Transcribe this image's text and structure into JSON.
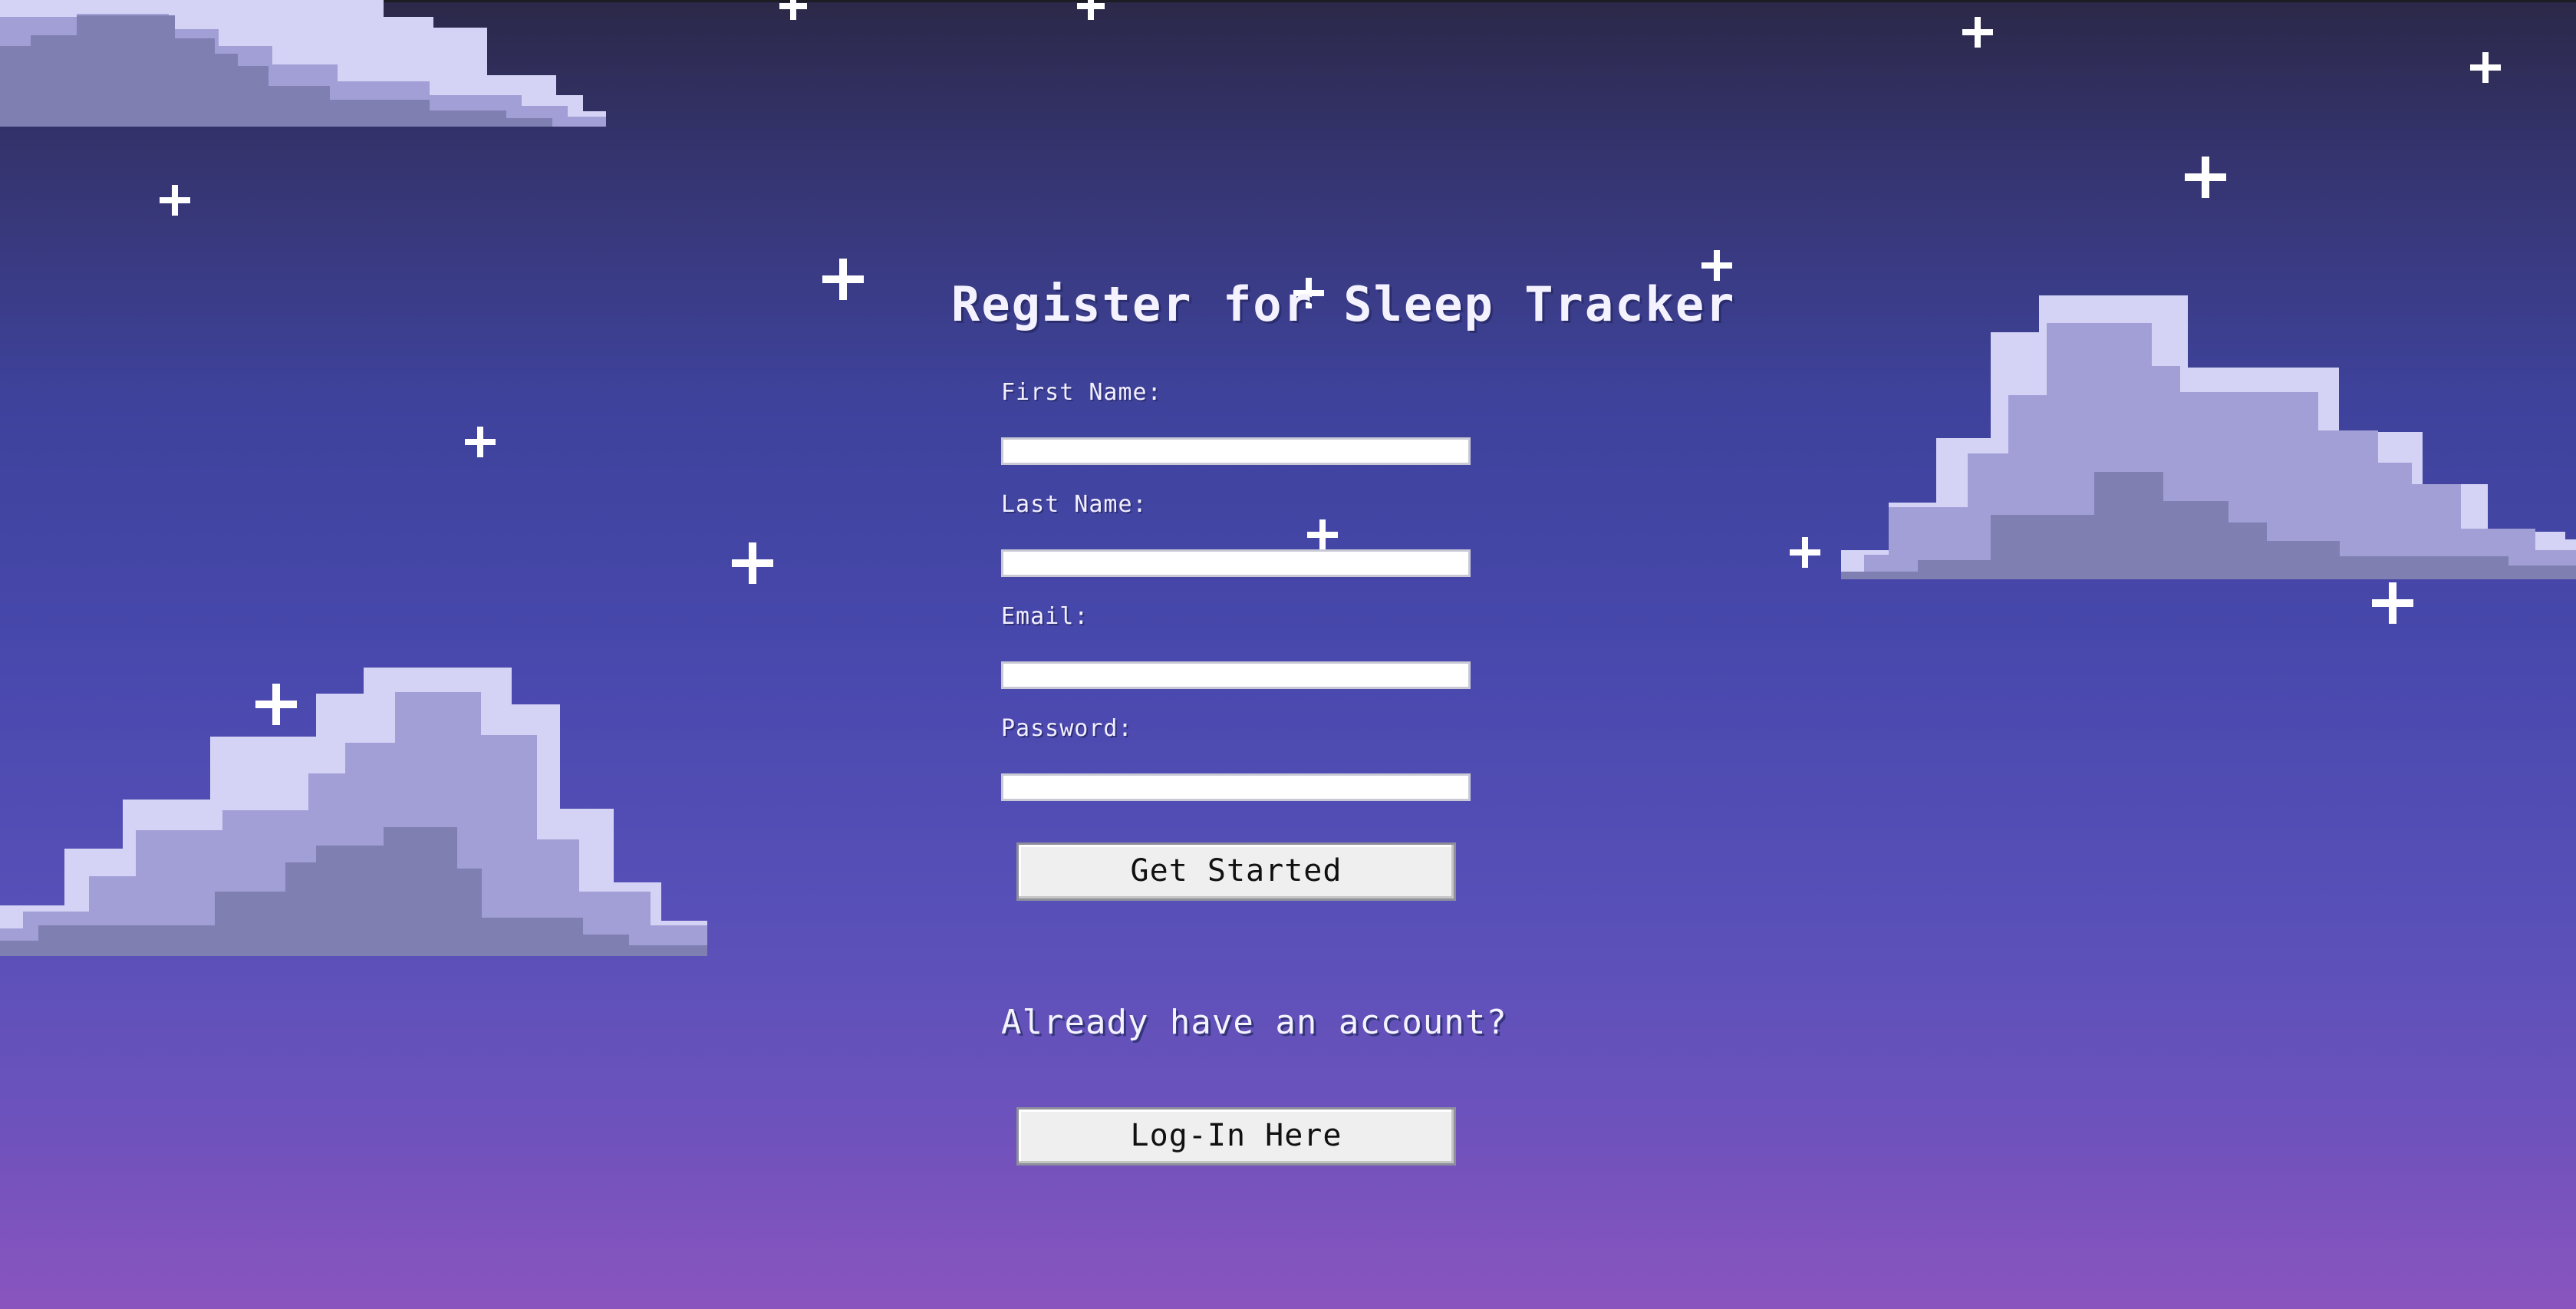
{
  "page": {
    "title": "Register for Sleep Tracker"
  },
  "form": {
    "first_name": {
      "label": "First Name:",
      "value": "",
      "placeholder": ""
    },
    "last_name": {
      "label": "Last Name:",
      "value": "",
      "placeholder": ""
    },
    "email": {
      "label": "Email:",
      "value": "",
      "placeholder": ""
    },
    "password": {
      "label": "Password:",
      "value": "",
      "placeholder": ""
    },
    "submit_label": "Get Started"
  },
  "login": {
    "prompt": "Already have an account?",
    "button_label": "Log-In Here"
  },
  "icons": {
    "cloud": "cloud-icon",
    "star": "star-icon"
  },
  "colors": {
    "sky_top": "#2b2848",
    "sky_bottom": "#8a54be",
    "cloud_light": "#d4d3f5",
    "cloud_mid": "#a19fd6",
    "cloud_dark": "#7f7fb2",
    "star": "#ffffff"
  }
}
